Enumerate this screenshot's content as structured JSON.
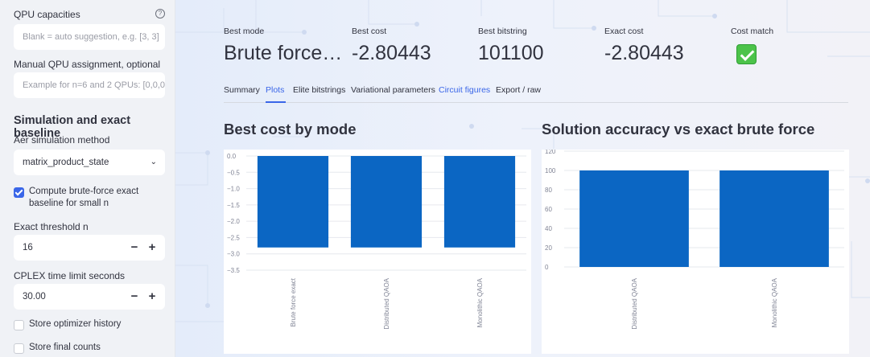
{
  "sidebar": {
    "qpu_capacities_label": "QPU capacities",
    "qpu_capacities_help": "?",
    "qpu_capacities_placeholder": "Blank = auto suggestion, e.g. [3, 3]",
    "manual_assignment_label": "Manual QPU assignment, optional",
    "manual_assignment_placeholder": "Example for n=6 and 2 QPUs: [0,0,0,1,1,1]",
    "section_heading": "Simulation and exact baseline",
    "aer_method_label": "Aer simulation method",
    "aer_method_value": "matrix_product_state",
    "brute_force_checkbox_label": "Compute brute-force exact baseline for small n",
    "brute_force_checked": true,
    "exact_threshold_label": "Exact threshold n",
    "exact_threshold_value": "16",
    "cplex_label": "CPLEX time limit seconds",
    "cplex_value": "30.00",
    "store_history_label": "Store optimizer history",
    "store_history_checked": false,
    "store_counts_label": "Store final counts",
    "store_counts_checked": false,
    "minus": "−",
    "plus": "+"
  },
  "metrics": {
    "best_mode_label": "Best mode",
    "best_mode_value": "Brute force…",
    "best_cost_label": "Best cost",
    "best_cost_value": "-2.80443",
    "best_bitstring_label": "Best bitstring",
    "best_bitstring_value": "101100",
    "exact_cost_label": "Exact cost",
    "exact_cost_value": "-2.80443",
    "cost_match_label": "Cost match"
  },
  "tabs": [
    {
      "label": "Summary"
    },
    {
      "label": "Plots"
    },
    {
      "label": "Elite bitstrings"
    },
    {
      "label": "Variational parameters"
    },
    {
      "label": "Circuit figures"
    },
    {
      "label": "Export / raw"
    }
  ],
  "colors": {
    "accent": "#3a66e8",
    "bar": "#0b66c3",
    "success": "#4cc34a"
  },
  "chart_data": [
    {
      "type": "bar",
      "title": "Best cost by mode",
      "categories": [
        "Brute force exact",
        "Distributed QAOA",
        "Monolithic QAOA"
      ],
      "values": [
        -2.80443,
        -2.80443,
        -2.80443
      ],
      "ylim": [
        -3.5,
        0.0
      ],
      "yticks": [
        "0.0",
        "−0.5",
        "−1.0",
        "−1.5",
        "−2.0",
        "−2.5",
        "−3.0",
        "−3.5"
      ],
      "ytick_values": [
        0.0,
        -0.5,
        -1.0,
        -1.5,
        -2.0,
        -2.5,
        -3.0,
        -3.5
      ],
      "grid": true
    },
    {
      "type": "bar",
      "title": "Solution accuracy vs exact brute force",
      "categories": [
        "Distributed QAOA",
        "Monolithic QAOA"
      ],
      "values": [
        100,
        100
      ],
      "ylim": [
        0,
        120
      ],
      "yticks": [
        "120",
        "100",
        "80",
        "60",
        "40",
        "20",
        "0"
      ],
      "ytick_values": [
        120,
        100,
        80,
        60,
        40,
        20,
        0
      ],
      "grid": true
    }
  ]
}
